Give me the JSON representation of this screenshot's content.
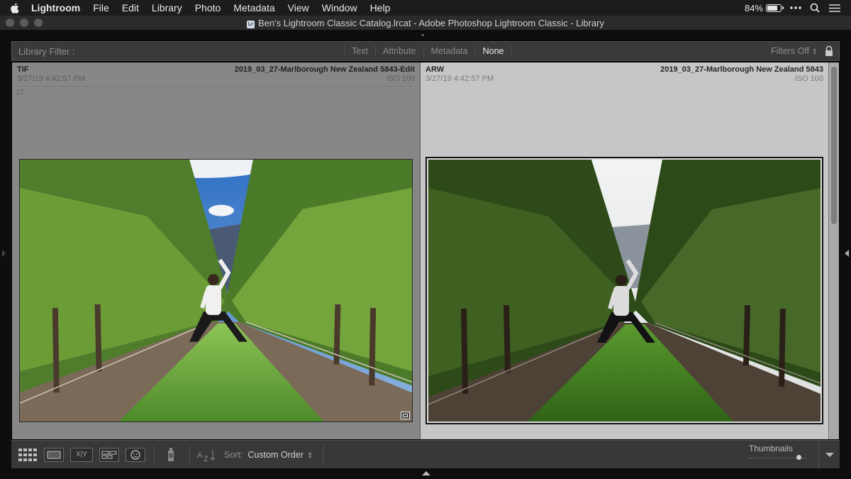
{
  "menubar": {
    "app_name": "Lightroom",
    "items": [
      "File",
      "Edit",
      "Library",
      "Photo",
      "Metadata",
      "View",
      "Window",
      "Help"
    ],
    "battery_percent": "84%",
    "battery_level": 0.84
  },
  "window": {
    "title": "Ben's Lightroom Classic Catalog.lrcat - Adobe Photoshop Lightroom Classic - Library",
    "lr_badge": "Lr"
  },
  "filterbar": {
    "label": "Library Filter :",
    "tabs": [
      "Text",
      "Attribute",
      "Metadata",
      "None"
    ],
    "selected_tab": "None",
    "filters_status": "Filters Off"
  },
  "compare": {
    "select": {
      "format": "TIF",
      "filename": "2019_03_27-Marlborough New Zealand 5843-Edit",
      "datetime": "3/27/19 4:42:57 PM",
      "iso": "ISO 100"
    },
    "candidate": {
      "format": "ARW",
      "filename": "2019_03_27-Marlborough New Zealand 5843",
      "datetime": "3/27/19 4:42:57 PM",
      "iso": "ISO 100"
    }
  },
  "toolbar": {
    "compare_label": "X|Y",
    "sort_label": "Sort:",
    "sort_value": "Custom Order",
    "thumbnails_label": "Thumbnails",
    "thumbnail_size": 0.88
  },
  "colors": {
    "panel_bg": "#383838",
    "select_pane_bg": "#878787",
    "candidate_pane_bg": "#c6c6c6",
    "selected_text": "#ececec"
  },
  "icons": {
    "apple": "apple-icon",
    "battery": "battery-charging-icon",
    "more": "more-icon",
    "search": "search-icon",
    "control_center": "control-center-icon",
    "lock": "lock-icon",
    "flag": "flag-icon",
    "grid_view": "grid-view-icon",
    "loupe_view": "loupe-view-icon",
    "compare_view": "compare-view-icon",
    "survey_view": "survey-view-icon",
    "people_view": "people-view-icon",
    "painter": "painter-icon",
    "sort_direction": "sort-direction-icon"
  }
}
